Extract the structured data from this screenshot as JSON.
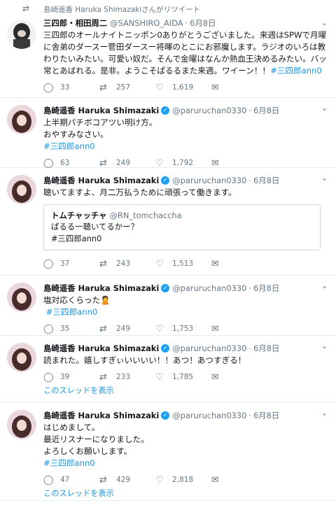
{
  "retweet_line": "島崎遥香 Haruka Shimazakiさんがリツイート",
  "icons": {
    "reply": "reply-icon",
    "retweet": "retweet-icon",
    "like": "heart-icon",
    "dm": "mail-icon",
    "caret": "chevron-down-icon",
    "verified": "verified-badge-icon"
  },
  "colors": {
    "link": "#1b95e0",
    "muted": "#657786",
    "verified": "#1da1f2",
    "border": "#e6ecf0"
  },
  "tweets": [
    {
      "name": "三四郎・相田周二",
      "handle": "@SANSHIRO_AIDA",
      "date": "6月8日",
      "text": "三四郎のオールナイトニッポン0ありがとうございました。来週はSPWで月曜に舎弟のダースー菅田ダースー将暉のとこにお邪魔します。ラジオのいろは教わりたいみたい。可愛い奴だ。そんで金曜はなんか熱血王決めるみたい。バッ常とあばれる。是非。ようこそぱるるまた来週。ワイーン！！",
      "hashtag": "#三四郎ann0",
      "replies": "33",
      "retweets": "257",
      "likes": "1,619"
    },
    {
      "name": "島崎遥香 Haruka Shimazaki",
      "handle": "@paruruchan0330",
      "date": "6月8日",
      "text": "上半期パチボコアツい明け方。\nおやすみなさい。",
      "hashtag": "#三四郎ann0",
      "replies": "63",
      "retweets": "249",
      "likes": "1,792"
    },
    {
      "name": "島崎遥香 Haruka Shimazaki",
      "handle": "@paruruchan0330",
      "date": "6月8日",
      "text": "聴いてますよ、月二万払うために頑張って働きます。",
      "quote": {
        "name": "トムチャッチャ",
        "handle": "@RN_tomchaccha",
        "text": "ぱるる一聴いてるかー？\n#三四郎ann0"
      },
      "replies": "37",
      "retweets": "243",
      "likes": "1,513"
    },
    {
      "name": "島崎遥香 Haruka Shimazaki",
      "handle": "@paruruchan0330",
      "date": "6月8日",
      "text": "塩対応くらった🙎",
      "hashtag": " #三四郎ann0",
      "replies": "35",
      "retweets": "249",
      "likes": "1,753"
    },
    {
      "name": "島崎遥香 Haruka Shimazaki",
      "handle": "@paruruchan0330",
      "date": "6月8日",
      "text": "読まれた。嬉しすぎぃいいいい！！あつ！あつすぎる！",
      "replies": "39",
      "retweets": "233",
      "likes": "1,785",
      "thread": "このスレッドを表示"
    },
    {
      "name": "島崎遥香 Haruka Shimazaki",
      "handle": "@paruruchan0330",
      "date": "6月8日",
      "text": "はじめまして。\n最近リスナーになりました。\nよろしくお願いします。",
      "hashtag": "#三四郎ann0",
      "replies": "47",
      "retweets": "429",
      "likes": "2,818",
      "thread": "このスレッドを表示"
    }
  ]
}
